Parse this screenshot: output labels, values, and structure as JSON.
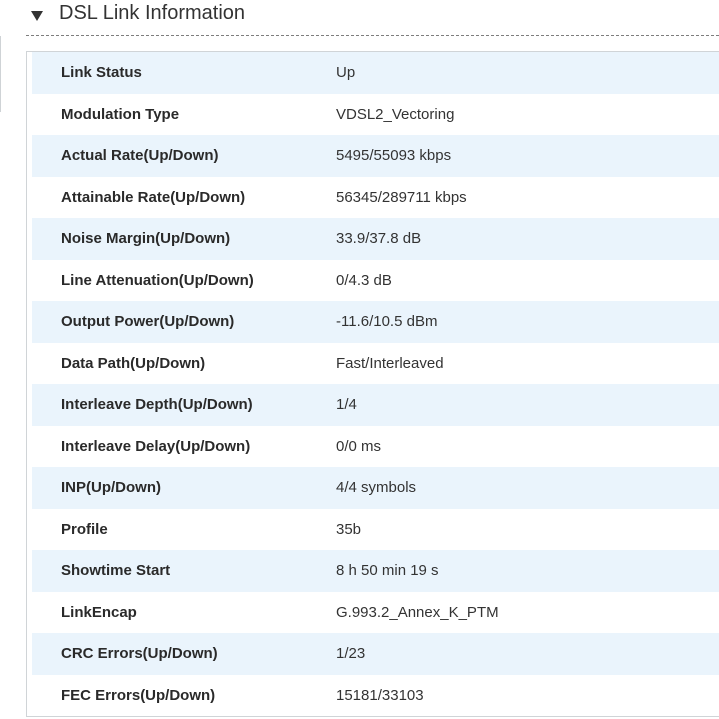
{
  "section": {
    "title": "DSL Link Information",
    "toggle_icon": "triangle-down-icon"
  },
  "rows": [
    {
      "label": "Link Status",
      "value": "Up"
    },
    {
      "label": "Modulation Type",
      "value": "VDSL2_Vectoring"
    },
    {
      "label": "Actual Rate(Up/Down)",
      "value": "5495/55093 kbps"
    },
    {
      "label": "Attainable Rate(Up/Down)",
      "value": "56345/289711 kbps"
    },
    {
      "label": "Noise Margin(Up/Down)",
      "value": "33.9/37.8 dB"
    },
    {
      "label": "Line Attenuation(Up/Down)",
      "value": "0/4.3 dB"
    },
    {
      "label": "Output Power(Up/Down)",
      "value": "-11.6/10.5 dBm"
    },
    {
      "label": "Data Path(Up/Down)",
      "value": "Fast/Interleaved"
    },
    {
      "label": "Interleave Depth(Up/Down)",
      "value": "1/4"
    },
    {
      "label": "Interleave Delay(Up/Down)",
      "value": "0/0 ms"
    },
    {
      "label": "INP(Up/Down)",
      "value": "4/4 symbols"
    },
    {
      "label": "Profile",
      "value": "35b"
    },
    {
      "label": "Showtime Start",
      "value": "8 h 50 min 19 s"
    },
    {
      "label": "LinkEncap",
      "value": "G.993.2_Annex_K_PTM"
    },
    {
      "label": "CRC Errors(Up/Down)",
      "value": "1/23"
    },
    {
      "label": "FEC Errors(Up/Down)",
      "value": "15181/33103"
    }
  ],
  "colors": {
    "row_stripe": "#eaf4fc",
    "text": "#222222",
    "border": "#d0d4d7"
  }
}
